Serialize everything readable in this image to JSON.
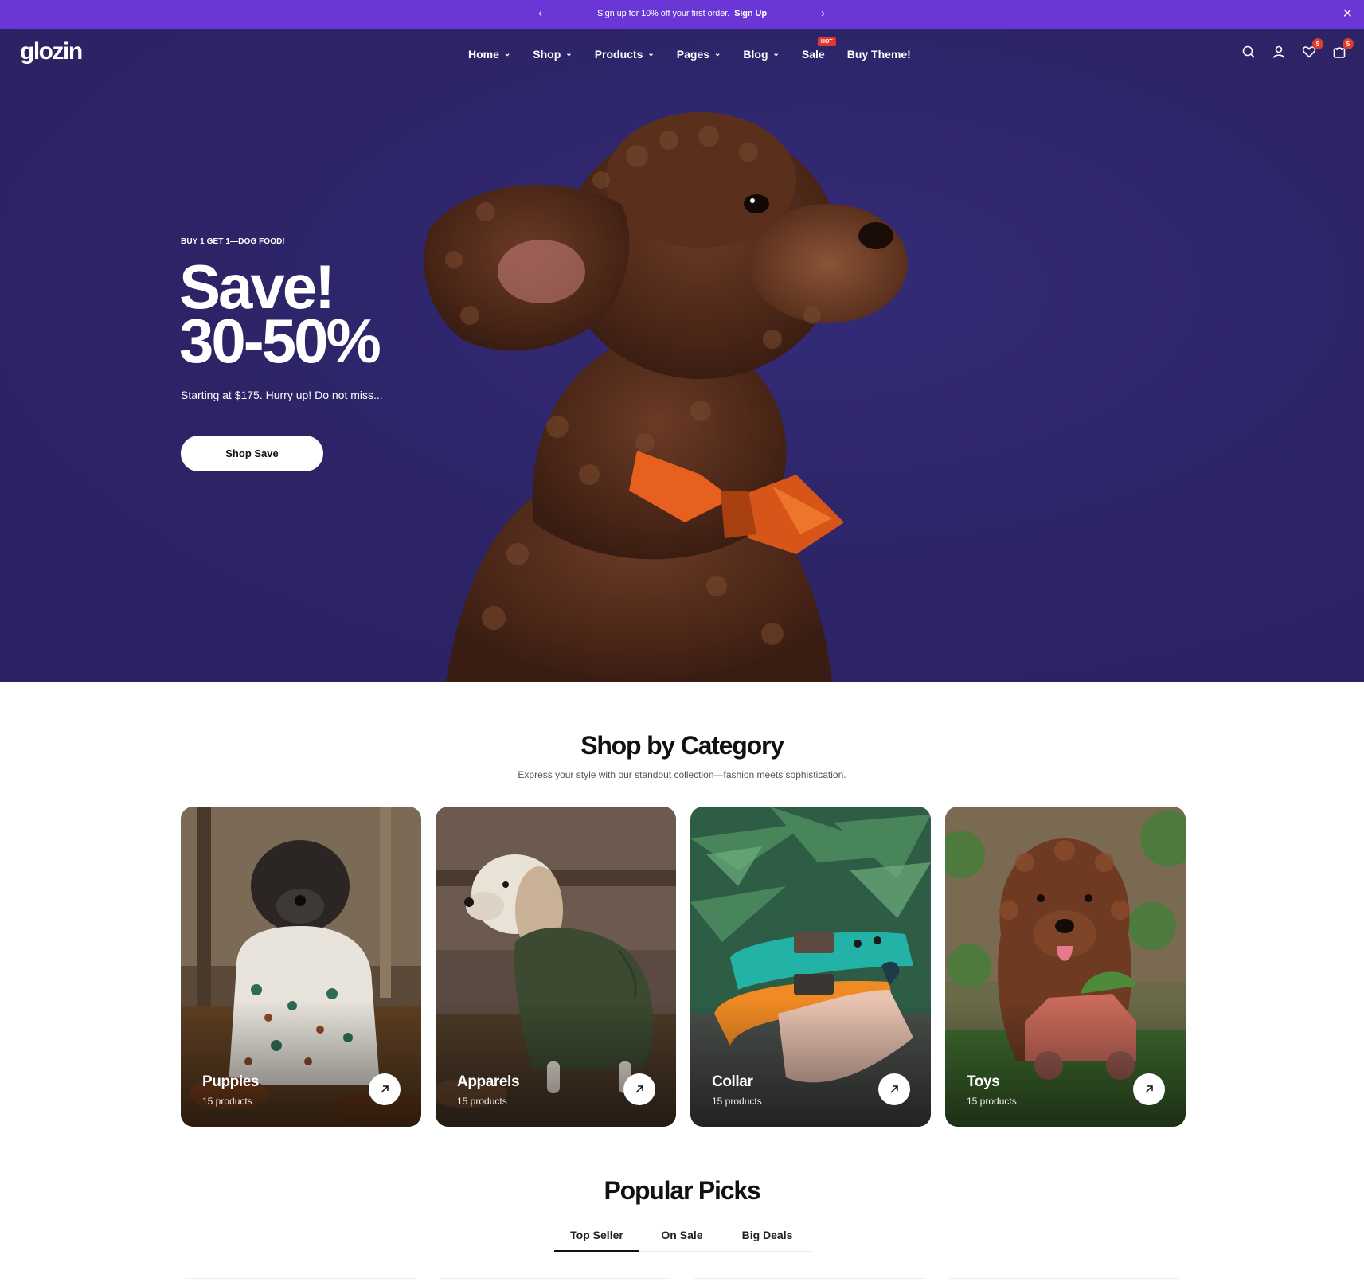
{
  "announcement": {
    "text": "Sign up for 10% off your first order.",
    "link": "Sign Up",
    "prev_icon": "chevron-left-icon",
    "next_icon": "chevron-right-icon",
    "close_icon": "close-icon"
  },
  "header": {
    "logo": "glozin",
    "nav": [
      {
        "label": "Home",
        "has_dropdown": true
      },
      {
        "label": "Shop",
        "has_dropdown": true
      },
      {
        "label": "Products",
        "has_dropdown": true
      },
      {
        "label": "Pages",
        "has_dropdown": true
      },
      {
        "label": "Blog",
        "has_dropdown": true
      },
      {
        "label": "Sale",
        "badge": "HOT"
      },
      {
        "label": "Buy Theme!"
      }
    ],
    "icons": {
      "search": "search-icon",
      "account": "user-icon",
      "wishlist": "heart-icon",
      "wishlist_count": "5",
      "cart": "cart-icon",
      "cart_count": "5"
    }
  },
  "hero": {
    "kicker": "BUY 1 GET 1—DOG FOOD!",
    "title_line1": "Save!",
    "title_line2": "30-50%",
    "subtitle": "Starting at $175. Hurry up! Do not miss...",
    "button": "Shop Save",
    "background_color": "#2c2466"
  },
  "categories": {
    "title": "Shop by Category",
    "subtitle": "Express your style with our standout collection—fashion meets sophistication.",
    "items": [
      {
        "name": "Puppies",
        "count": "15 products"
      },
      {
        "name": "Apparels",
        "count": "15 products"
      },
      {
        "name": "Collar",
        "count": "15 products"
      },
      {
        "name": "Toys",
        "count": "15 products"
      }
    ]
  },
  "popular": {
    "title": "Popular Picks",
    "tabs": [
      "Top Seller",
      "On Sale",
      "Big Deals"
    ],
    "active_tab": "Top Seller"
  },
  "colors": {
    "accent": "#6a36d6",
    "hero_bg": "#2c2466",
    "badge": "#e0392f"
  }
}
